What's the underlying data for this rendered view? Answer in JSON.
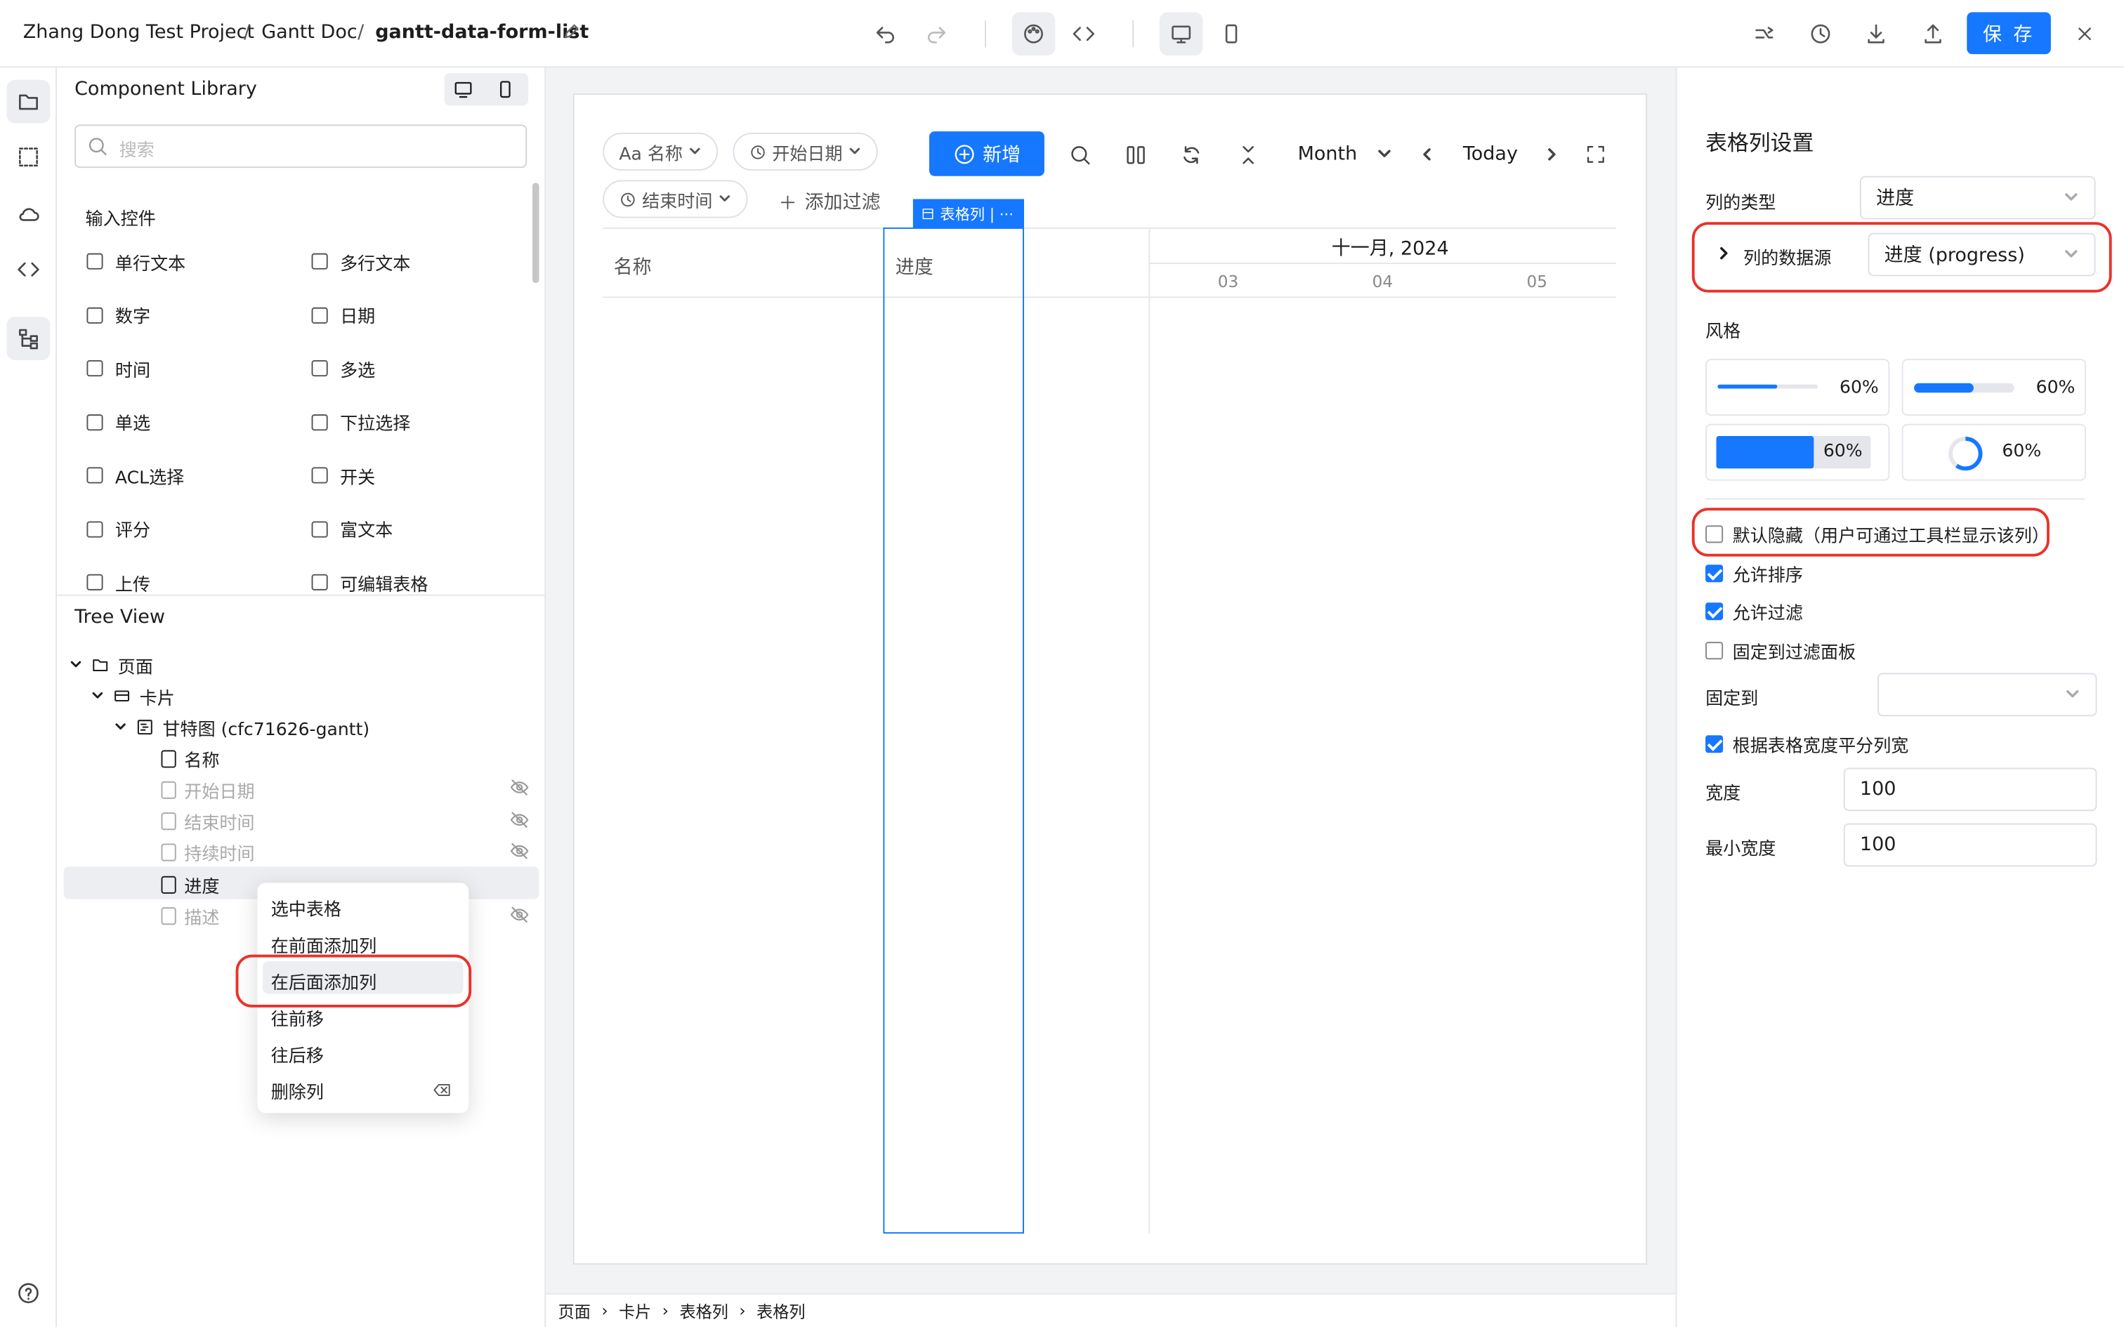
{
  "header": {
    "project": "Zhang Dong Test Project",
    "doc": "Gantt Doc",
    "page": "gantt-data-form-list",
    "save_label": "保 存"
  },
  "library": {
    "title": "Component Library",
    "search_placeholder": "搜索",
    "group_title": "输入控件",
    "components": [
      [
        "单行文本",
        "多行文本"
      ],
      [
        "数字",
        "日期"
      ],
      [
        "时间",
        "多选"
      ],
      [
        "单选",
        "下拉选择"
      ],
      [
        "ACL选择",
        "开关"
      ],
      [
        "评分",
        "富文本"
      ],
      [
        "上传",
        "可编辑表格"
      ]
    ]
  },
  "tree": {
    "title": "Tree View",
    "page": "页面",
    "card": "卡片",
    "gantt": "甘特图 (cfc71626-gantt)",
    "columns": [
      {
        "label": "名称",
        "hidden": false
      },
      {
        "label": "开始日期",
        "hidden": true
      },
      {
        "label": "结束时间",
        "hidden": true
      },
      {
        "label": "持续时间",
        "hidden": true
      },
      {
        "label": "进度",
        "hidden": false
      },
      {
        "label": "描述",
        "hidden": true
      }
    ]
  },
  "context_menu": {
    "items": [
      "选中表格",
      "在前面添加列",
      "在后面添加列",
      "往前移",
      "往后移",
      "删除列"
    ],
    "highlighted": "在后面添加列"
  },
  "canvas": {
    "filters": {
      "name": "Aa 名称",
      "start": "开始日期",
      "end": "结束时间",
      "add_filter": "添加过滤"
    },
    "add_button": "新增",
    "view_mode": "Month",
    "today": "Today",
    "tag": "表格列 | ···",
    "col_name": "名称",
    "col_progress": "进度",
    "month_label": "十一月, 2024",
    "days": [
      "03",
      "04",
      "05"
    ]
  },
  "breadcrumb": [
    "页面",
    "卡片",
    "表格列",
    "表格列"
  ],
  "props": {
    "title": "表格列设置",
    "col_type_label": "列的类型",
    "col_type_value": "进度",
    "source_label": "列的数据源",
    "source_value": "进度 (progress)",
    "style_label": "风格",
    "style_values": [
      "60%",
      "60%",
      "60%",
      "60%"
    ],
    "checkboxes": [
      {
        "label": "默认隐藏（用户可通过工具栏显示该列）",
        "checked": false
      },
      {
        "label": "允许排序",
        "checked": true
      },
      {
        "label": "允许过滤",
        "checked": true
      },
      {
        "label": "固定到过滤面板",
        "checked": false
      }
    ],
    "fixed_label": "固定到",
    "equal_width_label": "根据表格宽度平分列宽",
    "equal_width_checked": true,
    "width_label": "宽度",
    "width_value": "100",
    "min_width_label": "最小宽度",
    "min_width_value": "100"
  },
  "colors": {
    "accent": "#1677ff",
    "highlight": "#e8332b"
  }
}
